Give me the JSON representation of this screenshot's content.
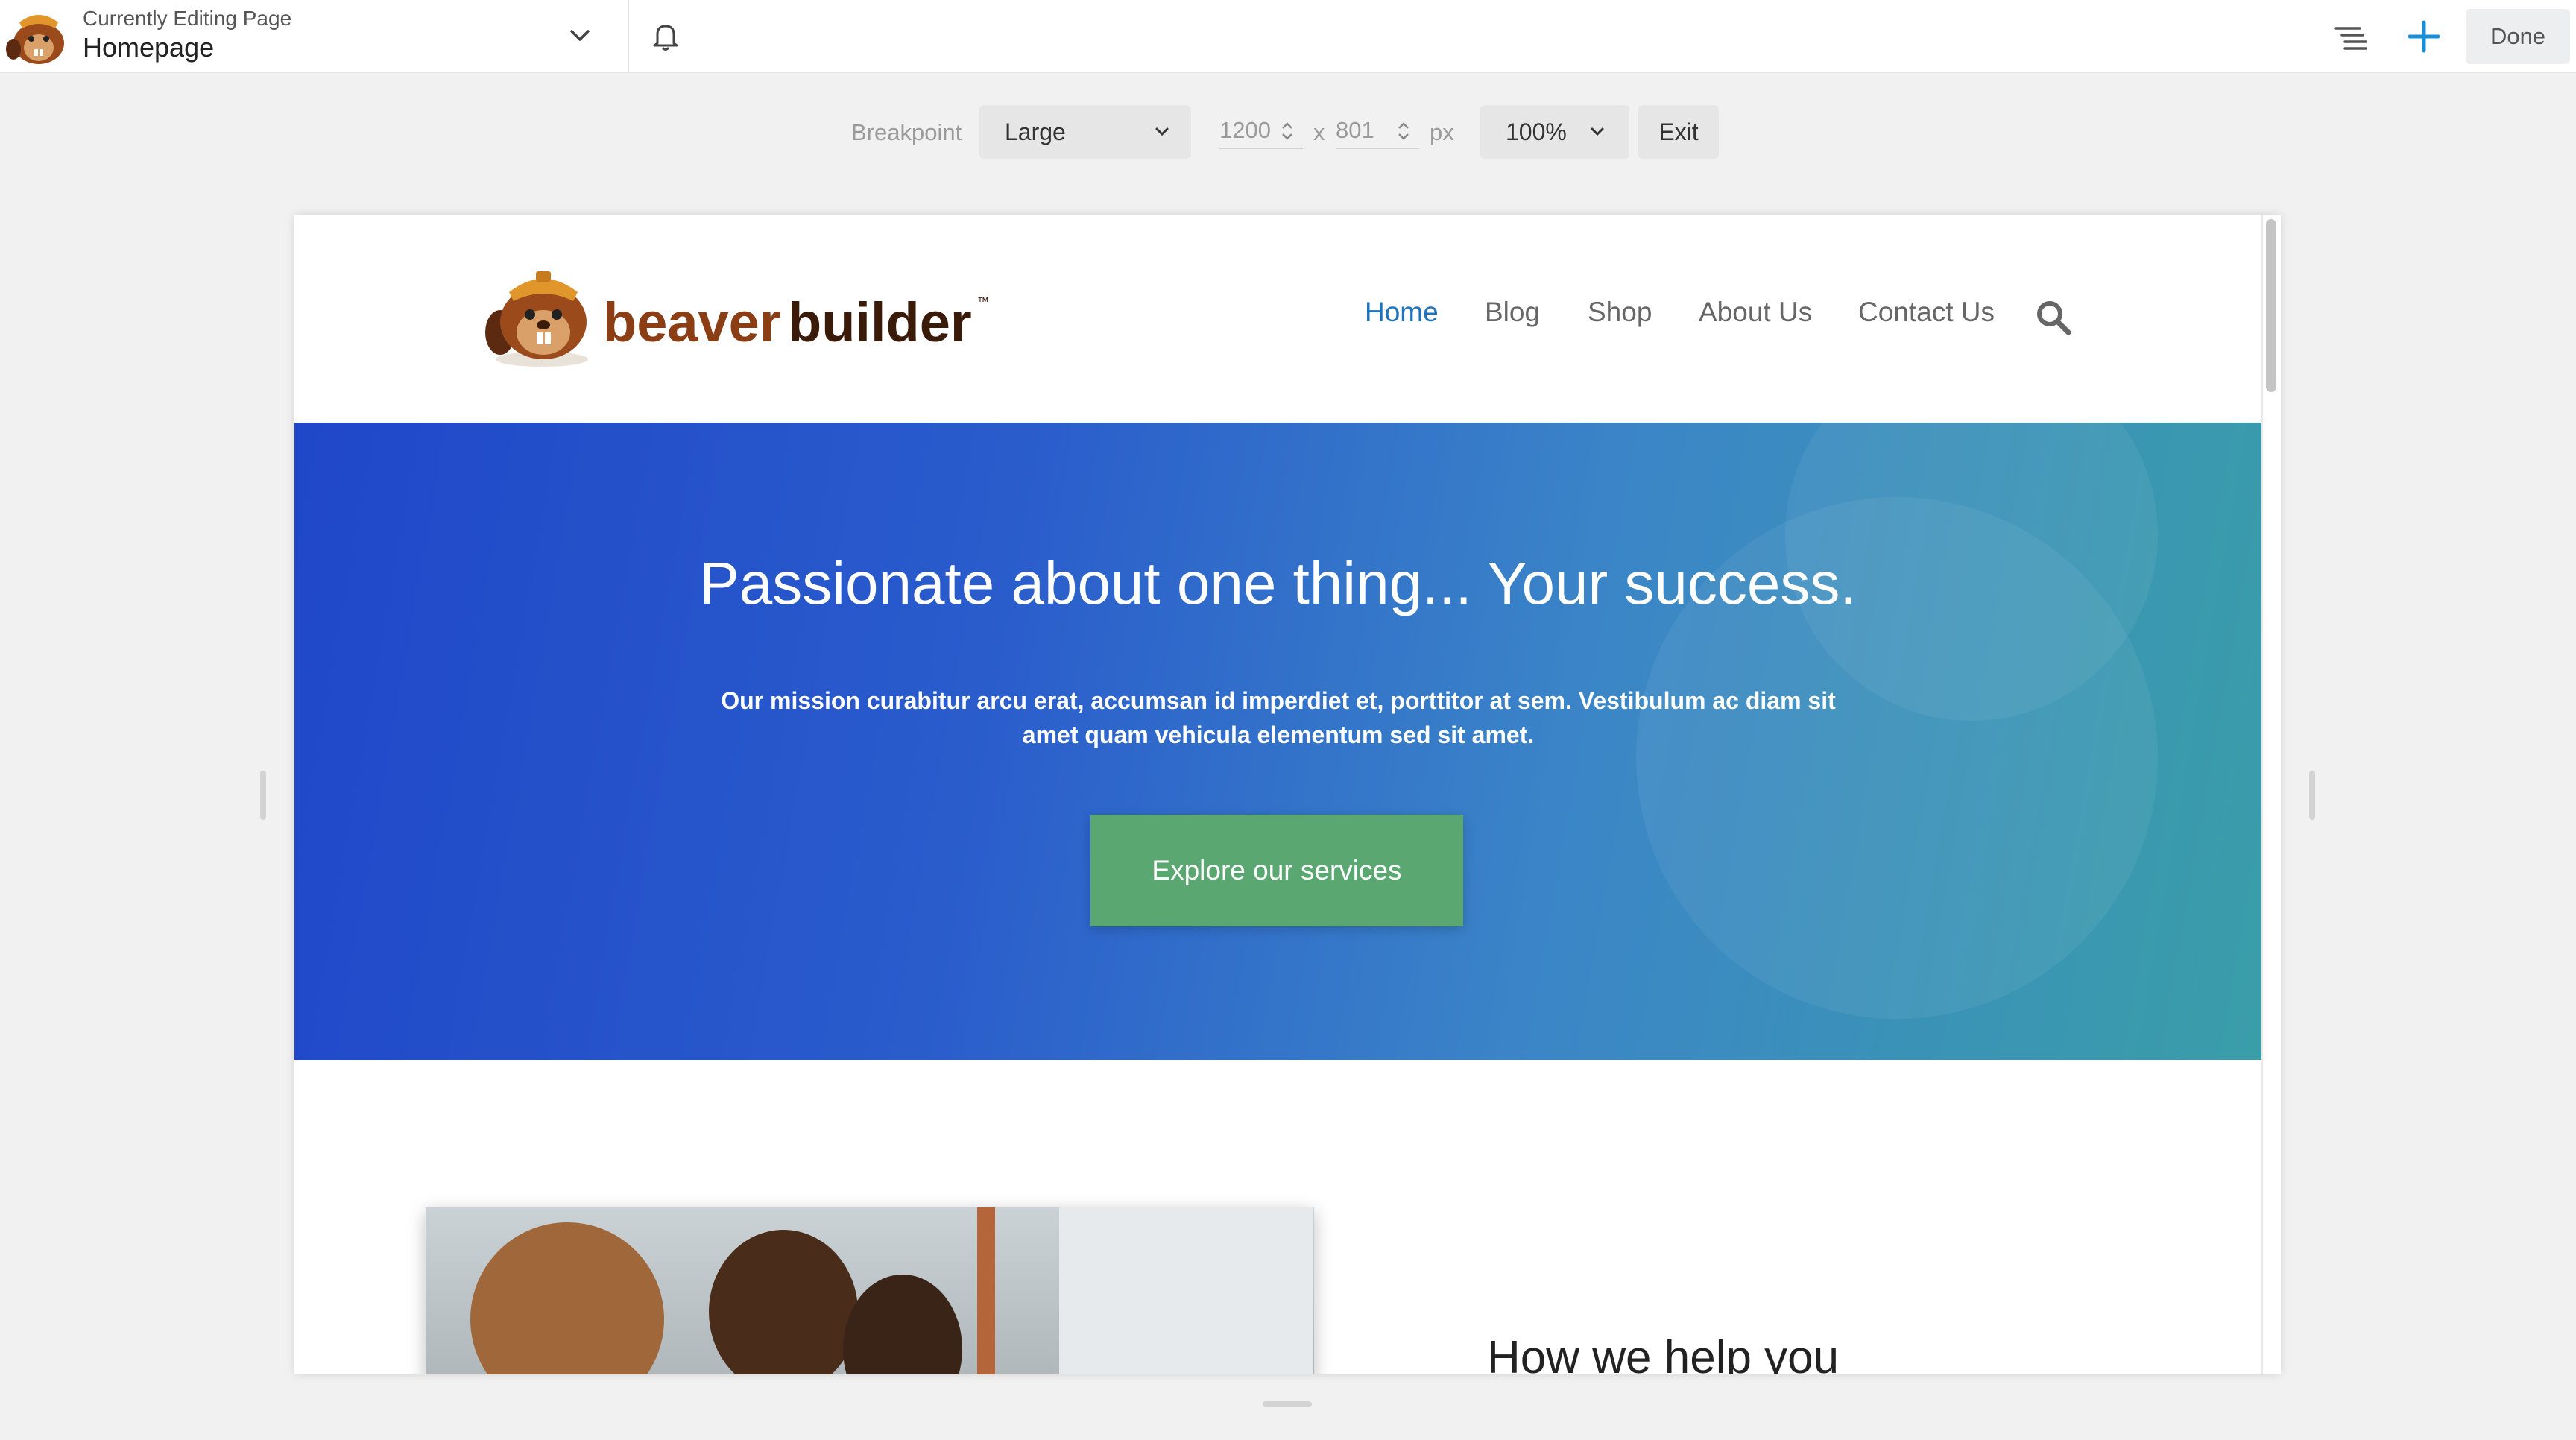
{
  "topbar": {
    "editing_label": "Currently Editing Page",
    "page_title": "Homepage",
    "done_label": "Done"
  },
  "toolbar": {
    "breakpoint_label": "Breakpoint",
    "breakpoint_value": "Large",
    "width_value": "1200",
    "height_value": "801",
    "dim_separator": "x",
    "unit": "px",
    "zoom_value": "100%",
    "exit_label": "Exit"
  },
  "site": {
    "logo_text_1": "beaver",
    "logo_text_2": "builder",
    "logo_tm": "™",
    "nav": [
      "Home",
      "Blog",
      "Shop",
      "About Us",
      "Contact Us"
    ],
    "active_nav": "Home"
  },
  "hero": {
    "title": "Passionate about one thing... Your success.",
    "text": "Our mission curabitur arcu erat, accumsan id imperdiet et, porttitor at sem. Vestibulum ac diam sit amet quam vehicula elementum sed sit amet.",
    "button_label": "Explore our services"
  },
  "section": {
    "heading": "How we help you"
  },
  "colors": {
    "accent": "#1e73be",
    "brand_brown": "#8b3d14",
    "hero_button": "#5aa772",
    "add_icon": "#1a8fd8"
  },
  "icons": [
    "beaver-logo-icon",
    "chevron-down-icon",
    "bell-icon",
    "outline-icon",
    "plus-icon",
    "search-icon"
  ]
}
